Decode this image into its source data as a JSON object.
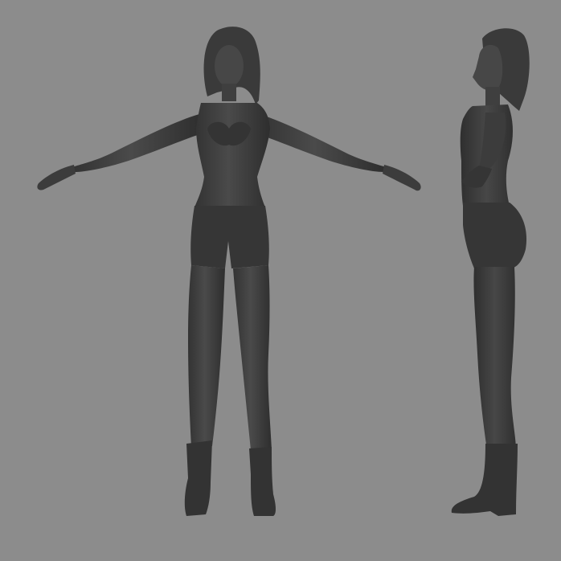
{
  "scene": {
    "background_color": "#8c8c8c",
    "model_color": "#3e3e3e",
    "model_shadow_color": "#2c2c2c",
    "model_highlight_color": "#565656",
    "views": [
      {
        "name": "front",
        "pose": "t-pose"
      },
      {
        "name": "side",
        "pose": "t-pose"
      }
    ]
  }
}
